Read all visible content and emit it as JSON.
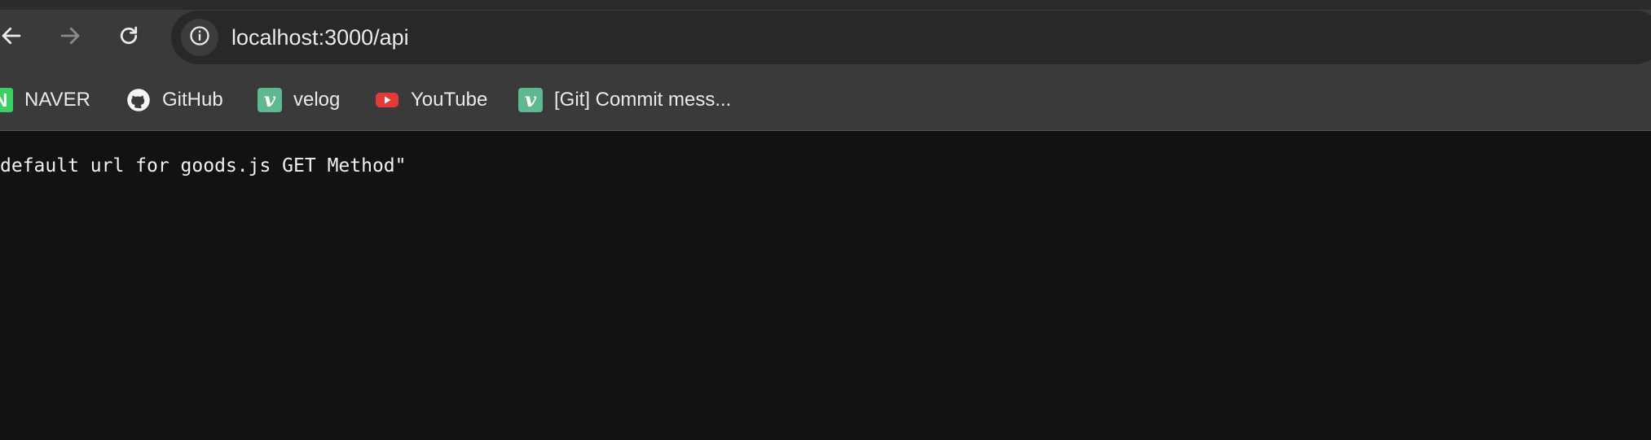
{
  "browser": {
    "address": "localhost:3000/api",
    "nav": {
      "back_icon": "arrow-left-icon",
      "forward_icon": "arrow-right-icon",
      "reload_icon": "reload-icon",
      "site_info_icon": "info-icon"
    },
    "colors": {
      "toolbar": "#3a3a3a",
      "omnibox": "#282828",
      "page_background": "#121212",
      "text": "#e8eaed"
    }
  },
  "bookmarks": [
    {
      "label": "NAVER",
      "icon": "naver-icon",
      "icon_text": "N",
      "color": "#3ccf62"
    },
    {
      "label": "GitHub",
      "icon": "github-icon"
    },
    {
      "label": "velog",
      "icon": "velog-icon",
      "icon_text": "v",
      "color": "#5fb88f"
    },
    {
      "label": "YouTube",
      "icon": "youtube-icon",
      "color": "#e53935"
    },
    {
      "label": "[Git] Commit mess...",
      "icon": "velog-icon",
      "icon_text": "v",
      "color": "#5fb88f"
    }
  ],
  "page": {
    "text": "default url for goods.js GET Method\""
  }
}
